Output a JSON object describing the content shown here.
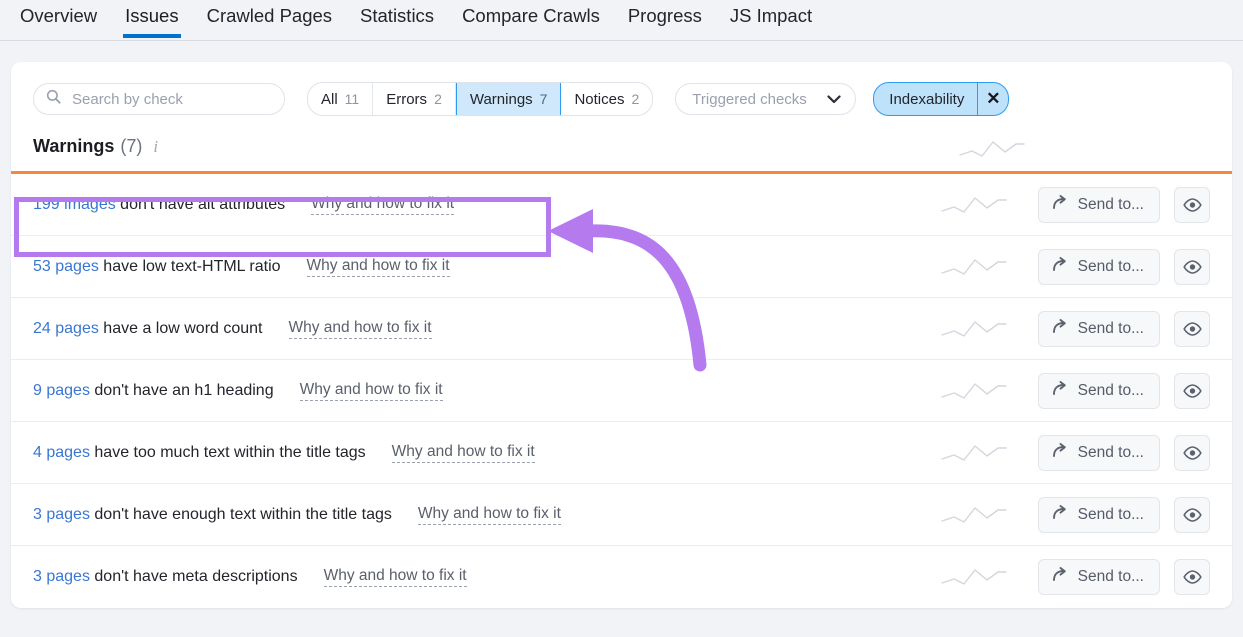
{
  "nav": {
    "tabs": [
      {
        "label": "Overview",
        "active": false
      },
      {
        "label": "Issues",
        "active": true
      },
      {
        "label": "Crawled Pages",
        "active": false
      },
      {
        "label": "Statistics",
        "active": false
      },
      {
        "label": "Compare Crawls",
        "active": false
      },
      {
        "label": "Progress",
        "active": false
      },
      {
        "label": "JS Impact",
        "active": false
      }
    ]
  },
  "filters": {
    "search": {
      "placeholder": "Search by check",
      "value": ""
    },
    "segments": [
      {
        "label": "All",
        "count": "11",
        "selected": false
      },
      {
        "label": "Errors",
        "count": "2",
        "selected": false
      },
      {
        "label": "Warnings",
        "count": "7",
        "selected": true
      },
      {
        "label": "Notices",
        "count": "2",
        "selected": false
      }
    ],
    "dropdown": {
      "label": "Triggered checks",
      "icon": "chevron-down-icon"
    },
    "chip": {
      "label": "Indexability",
      "remove": "✕"
    }
  },
  "section": {
    "title": "Warnings",
    "count": "(7)",
    "info_icon": "info-icon"
  },
  "rows": [
    {
      "count": "199 images",
      "text": "don't have alt attributes",
      "fix": "Why and how to fix it",
      "send": "Send to...",
      "highlighted": true
    },
    {
      "count": "53 pages",
      "text": "have low text-HTML ratio",
      "fix": "Why and how to fix it",
      "send": "Send to...",
      "highlighted": false
    },
    {
      "count": "24 pages",
      "text": "have a low word count",
      "fix": "Why and how to fix it",
      "send": "Send to...",
      "highlighted": false
    },
    {
      "count": "9 pages",
      "text": "don't have an h1 heading",
      "fix": "Why and how to fix it",
      "send": "Send to...",
      "highlighted": false
    },
    {
      "count": "4 pages",
      "text": "have too much text within the title tags",
      "fix": "Why and how to fix it",
      "send": "Send to...",
      "highlighted": false
    },
    {
      "count": "3 pages",
      "text": "don't have enough text within the title tags",
      "fix": "Why and how to fix it",
      "send": "Send to...",
      "highlighted": false
    },
    {
      "count": "3 pages",
      "text": "don't have meta descriptions",
      "fix": "Why and how to fix it",
      "send": "Send to...",
      "highlighted": false
    }
  ],
  "annotations": {
    "highlight_color": "#b57bee",
    "arrow_color": "#b57bee",
    "rule_color": "#f6883b",
    "accent_blue": "#0071cd",
    "chip_blue": "#bfe2fb"
  }
}
